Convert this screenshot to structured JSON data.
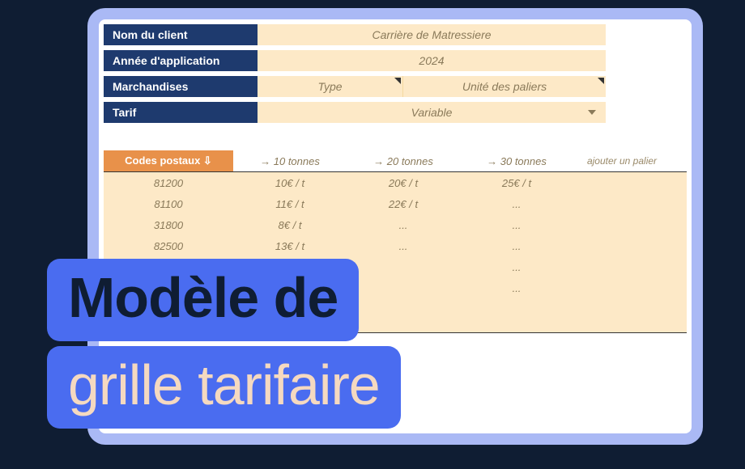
{
  "form": {
    "client_label": "Nom du client",
    "client_value": "Carrière de Matressiere",
    "year_label": "Année d'application",
    "year_value": "2024",
    "goods_label": "Marchandises",
    "goods_type": "Type",
    "goods_unit": "Unité des paliers",
    "tarif_label": "Tarif",
    "tarif_value": "Variable"
  },
  "table": {
    "codes_header": "Codes postaux ⇩",
    "tier1_header": "→ 10 tonnes",
    "tier2_header": "→ 20 tonnes",
    "tier3_header": "→ 30 tonnes",
    "add_tier": "ajouter un palier",
    "rows": [
      {
        "code": "81200",
        "t1": "10€ / t",
        "t2": "20€ / t",
        "t3": "25€ / t"
      },
      {
        "code": "81100",
        "t1": "11€ / t",
        "t2": "22€ / t",
        "t3": "..."
      },
      {
        "code": "31800",
        "t1": "8€ / t",
        "t2": "...",
        "t3": "..."
      },
      {
        "code": "82500",
        "t1": "13€ / t",
        "t2": "...",
        "t3": "..."
      },
      {
        "code": "",
        "t1": "",
        "t2": "",
        "t3": "..."
      },
      {
        "code": "",
        "t1": "",
        "t2": "",
        "t3": "..."
      }
    ]
  },
  "title": {
    "line1": "Modèle de",
    "line2": "grille tarifaire"
  }
}
